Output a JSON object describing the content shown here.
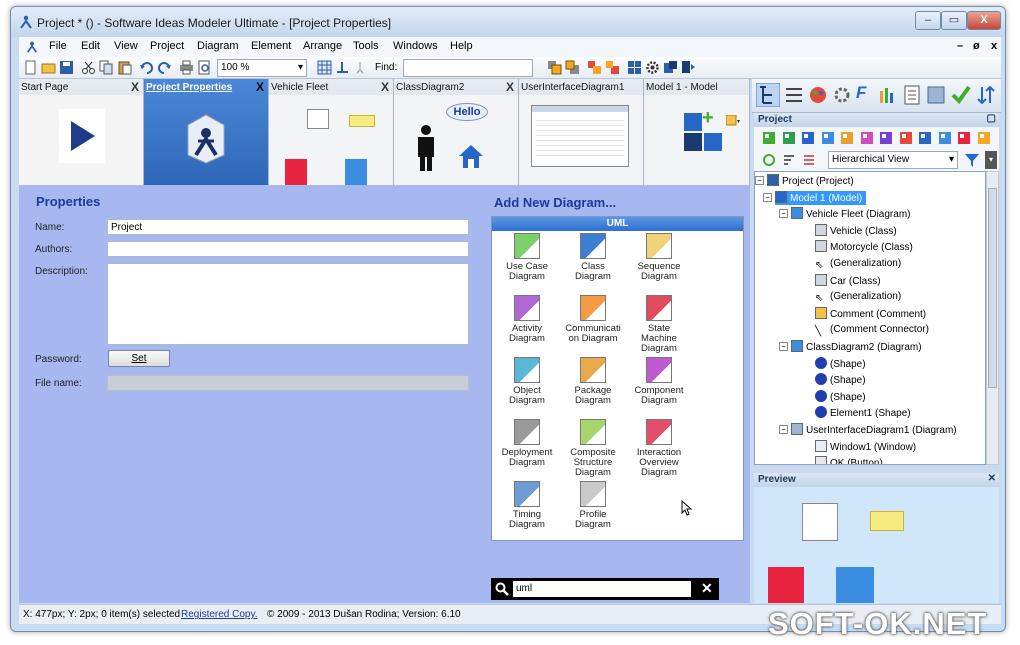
{
  "window": {
    "title": "Project * () - Software Ideas Modeler Ultimate - [Project Properties]",
    "min": "–",
    "max": "▭",
    "close": "X"
  },
  "menu": {
    "items": [
      "File",
      "Edit",
      "View",
      "Project",
      "Diagram",
      "Element",
      "Arrange",
      "Tools",
      "Windows",
      "Help"
    ],
    "mdi_min": "–",
    "mdi_restore": "ø",
    "mdi_close": "x"
  },
  "toolbar": {
    "zoom": "100 %",
    "find_label": "Find:",
    "find_value": ""
  },
  "tabs": [
    {
      "label": "Start Page"
    },
    {
      "label": "Project Properties"
    },
    {
      "label": "Vehicle Fleet"
    },
    {
      "label": "ClassDiagram2"
    },
    {
      "label": "UserInterfaceDiagram1"
    },
    {
      "label": "Model 1 - Model"
    }
  ],
  "tab_close": "X",
  "hello": "Hello",
  "properties": {
    "title": "Properties",
    "name_label": "Name:",
    "name_value": "Project",
    "authors_label": "Authors:",
    "authors_value": "",
    "description_label": "Description:",
    "description_value": "",
    "password_label": "Password:",
    "set_button": "Set",
    "filename_label": "File name:",
    "filename_value": ""
  },
  "add_diagram": {
    "title": "Add New Diagram...",
    "group": "UML",
    "items": [
      {
        "l1": "Use Case",
        "l2": "Diagram",
        "l3": "",
        "color": "#7bd06a"
      },
      {
        "l1": "Class",
        "l2": "Diagram",
        "l3": "",
        "color": "#3c7ed3"
      },
      {
        "l1": "Sequence",
        "l2": "Diagram",
        "l3": "",
        "color": "#f0d27a"
      },
      {
        "l1": "Activity",
        "l2": "Diagram",
        "l3": "",
        "color": "#b068d4"
      },
      {
        "l1": "Communicati",
        "l2": "on Diagram",
        "l3": "",
        "color": "#f39a42"
      },
      {
        "l1": "State",
        "l2": "Machine",
        "l3": "Diagram",
        "color": "#e24a5e"
      },
      {
        "l1": "Object",
        "l2": "Diagram",
        "l3": "",
        "color": "#5ab7d8"
      },
      {
        "l1": "Package",
        "l2": "Diagram",
        "l3": "",
        "color": "#e8a94a"
      },
      {
        "l1": "Component",
        "l2": "Diagram",
        "l3": "",
        "color": "#c05ad0"
      },
      {
        "l1": "Deployment",
        "l2": "Diagram",
        "l3": "",
        "color": "#9a9a9a"
      },
      {
        "l1": "Composite",
        "l2": "Structure",
        "l3": "Diagram",
        "color": "#a6d66b"
      },
      {
        "l1": "Interaction",
        "l2": "Overview",
        "l3": "Diagram",
        "color": "#e34e6a"
      },
      {
        "l1": "Timing",
        "l2": "Diagram",
        "l3": "",
        "color": "#6d9cd6"
      },
      {
        "l1": "Profile",
        "l2": "Diagram",
        "l3": "",
        "color": "#c9c9c9"
      }
    ]
  },
  "search": {
    "value": "uml",
    "clear": "✕"
  },
  "project_panel": {
    "title": "Project",
    "view_mode": "Hierarchical View"
  },
  "tree": [
    {
      "label": "Project (Project)",
      "level": 0,
      "exp": "−",
      "icon": "project-icon",
      "sel": false
    },
    {
      "label": "Model 1 (Model)",
      "level": 1,
      "exp": "−",
      "icon": "model-icon",
      "sel": true
    },
    {
      "label": "Vehicle Fleet (Diagram)",
      "level": 2,
      "exp": "−",
      "icon": "class-diagram-icon",
      "sel": false
    },
    {
      "label": "Vehicle (Class)",
      "level": 3,
      "exp": "",
      "icon": "class-icon",
      "sel": false
    },
    {
      "label": "Motorcycle (Class)",
      "level": 3,
      "exp": "",
      "icon": "class-icon",
      "sel": false
    },
    {
      "label": "(Generalization)",
      "level": 3,
      "exp": "",
      "icon": "generalization-icon",
      "sel": false
    },
    {
      "label": "Car (Class)",
      "level": 3,
      "exp": "",
      "icon": "class-icon",
      "sel": false
    },
    {
      "label": "(Generalization)",
      "level": 3,
      "exp": "",
      "icon": "generalization-icon",
      "sel": false
    },
    {
      "label": "Comment (Comment)",
      "level": 3,
      "exp": "",
      "icon": "comment-icon",
      "sel": false
    },
    {
      "label": "(Comment Connector)",
      "level": 3,
      "exp": "",
      "icon": "connector-icon",
      "sel": false
    },
    {
      "label": "ClassDiagram2 (Diagram)",
      "level": 2,
      "exp": "−",
      "icon": "class-diagram-icon",
      "sel": false
    },
    {
      "label": "(Shape)",
      "level": 3,
      "exp": "",
      "icon": "shape-icon",
      "sel": false
    },
    {
      "label": "(Shape)",
      "level": 3,
      "exp": "",
      "icon": "shape-icon",
      "sel": false
    },
    {
      "label": "(Shape)",
      "level": 3,
      "exp": "",
      "icon": "shape-icon",
      "sel": false
    },
    {
      "label": "Element1 (Shape)",
      "level": 3,
      "exp": "",
      "icon": "shape-icon",
      "sel": false
    },
    {
      "label": "UserInterfaceDiagram1 (Diagram)",
      "level": 2,
      "exp": "−",
      "icon": "ui-diagram-icon",
      "sel": false
    },
    {
      "label": "Window1 (Window)",
      "level": 3,
      "exp": "",
      "icon": "window-icon",
      "sel": false
    },
    {
      "label": "OK (Button)",
      "level": 3,
      "exp": "",
      "icon": "button-icon",
      "sel": false
    }
  ],
  "preview_panel": {
    "title": "Preview"
  },
  "status": {
    "coords": "X: 477px; Y: 2px; 0 item(s) selected",
    "registered": "Registered Copy.",
    "copyright": "© 2009 - 2013 Dušan Rodina; Version: 6.10"
  },
  "watermark": "SOFT-OK.NET",
  "colors": {
    "accent": "#2f67b8",
    "content_bg": "#a7b7f0",
    "heading": "#1b3a9a",
    "selection": "#3399ff"
  }
}
